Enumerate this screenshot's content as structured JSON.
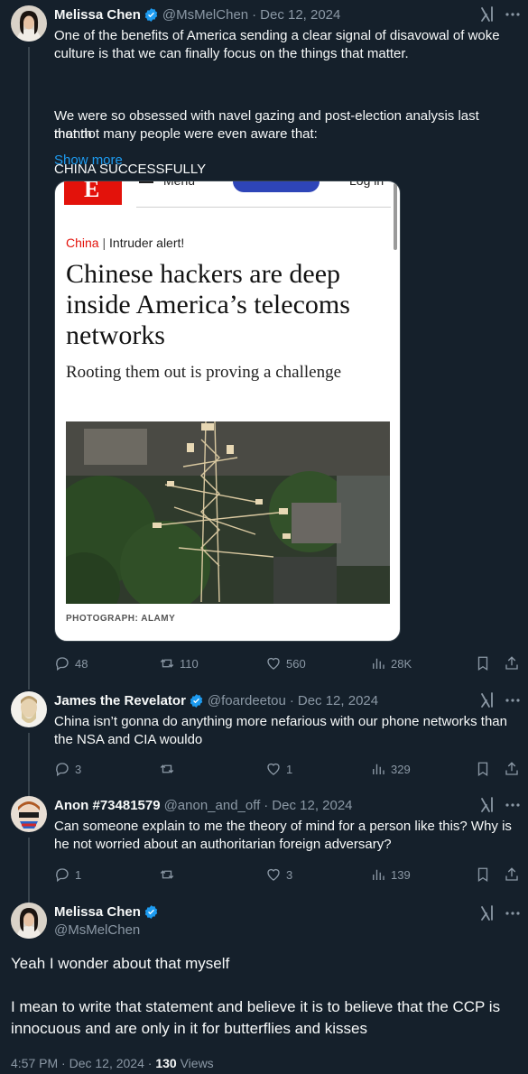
{
  "tweet1": {
    "name": "Melissa Chen",
    "handle": "@MsMelChen",
    "date": "Dec 12, 2024",
    "line1": "One of the benefits of America sending a clear signal of disavowal of woke",
    "line2": "culture is that we can finally focus on the things that matter.",
    "line3": "We were so obsessed with navel gazing and post-election analysis last month",
    "line4": "that not many people were even aware that:",
    "line5": "CHINA SUCCESSFULLY",
    "show_more": "Show more",
    "card": {
      "logo_letter": "E",
      "menu": "Menu",
      "login": "Log in",
      "section": "China",
      "kicker": "Intruder alert!",
      "title": "Chinese hackers are deep inside America’s telecoms networks",
      "subtitle": "Rooting them out is proving a challenge",
      "credit": "PHOTOGRAPH: ALAMY"
    },
    "replies": "48",
    "reposts": "110",
    "likes": "560",
    "views": "28K"
  },
  "reply1": {
    "name": "James the Revelator",
    "handle": "@foardeetou",
    "date": "Dec 12, 2024",
    "line1": "China isn’t gonna do anything more nefarious with our phone networks than",
    "line2": "the NSA and CIA wouldo",
    "replies": "3",
    "reposts": "",
    "likes": "1",
    "views": "329"
  },
  "reply2": {
    "name": "Anon #73481579",
    "handle": "@anon_and_off",
    "date": "Dec 12, 2024",
    "line1": "Can someone explain to me the theory of mind for a person like this? Why is",
    "line2": "he not worried about an authoritarian foreign adversary?",
    "replies": "1",
    "reposts": "",
    "likes": "3",
    "views": "139"
  },
  "main": {
    "name": "Melissa Chen",
    "handle": "@MsMelChen",
    "para1": "Yeah I wonder about that myself",
    "para2_line1": "I mean to write that statement and believe it is to believe that the CCP is",
    "para2_line2": "innocuous and are only in it for butterflies and kisses",
    "time": "4:57 PM",
    "date": "Dec 12, 2024",
    "views_count": "130",
    "views_label": "Views"
  },
  "colors": {
    "background": "#15202b",
    "accent": "#1d9bf0",
    "muted": "#8b98a5",
    "economist_red": "#e3120b"
  },
  "separator": "·"
}
